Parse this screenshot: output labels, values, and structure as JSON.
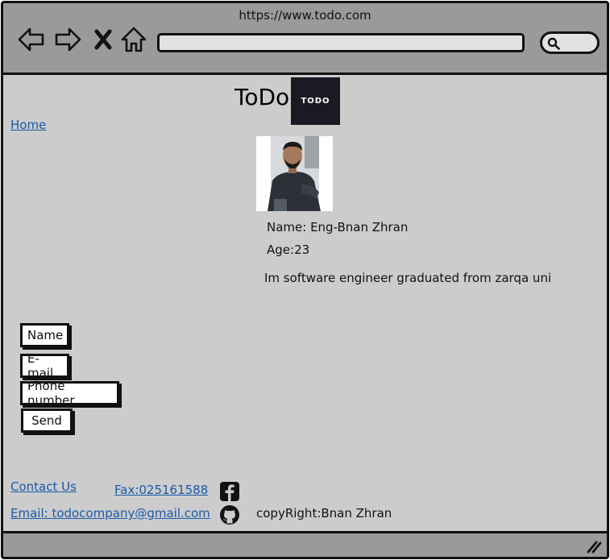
{
  "browser": {
    "url": "https://www.todo.com",
    "icons": {
      "back": "back-arrow-icon",
      "forward": "forward-arrow-icon",
      "stop": "close-icon",
      "home": "home-icon",
      "search": "search-icon"
    }
  },
  "header": {
    "title": "ToDo",
    "logo_text": "TODO"
  },
  "nav": {
    "home": "Home"
  },
  "profile": {
    "name": "Name: Eng-Bnan Zhran",
    "age": "Age:23",
    "bio": "Im software engineer graduated from zarqa uni"
  },
  "form": {
    "name": "Name",
    "email": "E-mail",
    "phone": "Phone number",
    "send": "Send"
  },
  "footer": {
    "contact": "Contact Us",
    "fax": "Fax:025161588",
    "email": "Email: todocompany@gmail.com",
    "copyright": "copyRight:Bnan Zhran",
    "icons": {
      "facebook": "facebook-icon",
      "github": "github-icon"
    }
  },
  "colors": {
    "chrome": "#9a9a9a",
    "page": "#cccccc",
    "link": "#1a5aa8",
    "logo_bg": "#1b1a24"
  }
}
